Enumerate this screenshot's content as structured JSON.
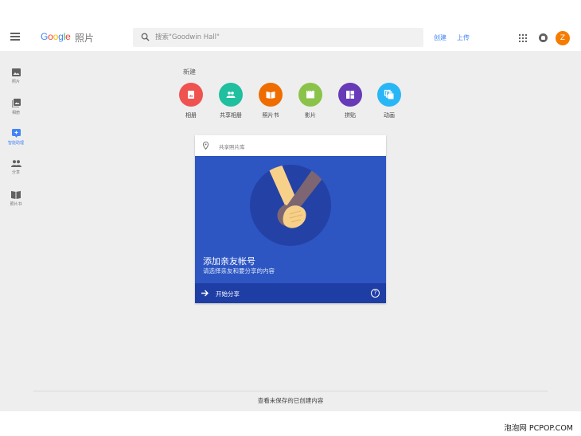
{
  "header": {
    "logo_letters": [
      "G",
      "o",
      "o",
      "g",
      "l",
      "e"
    ],
    "product": "照片",
    "search_placeholder": "搜索\"Goodwin Hall\"",
    "create_link": "创建",
    "upload_link": "上传",
    "avatar_letter": "Z",
    "avatar_color": "#f57c00"
  },
  "sidebar": {
    "items": [
      {
        "label": "照片",
        "icon": "photo-icon"
      },
      {
        "label": "相册",
        "icon": "album-icon"
      },
      {
        "label": "智能助理",
        "icon": "assistant-icon",
        "active": true
      },
      {
        "label": "分享",
        "icon": "people-icon"
      },
      {
        "label": "照片书",
        "icon": "photobook-icon"
      }
    ]
  },
  "create_section": {
    "label": "新建",
    "items": [
      {
        "label": "相册",
        "color": "#ef5350",
        "icon": "album-icon"
      },
      {
        "label": "共享相册",
        "color": "#1fbfa0",
        "icon": "shared-album-icon"
      },
      {
        "label": "照片书",
        "color": "#ef6c00",
        "icon": "photobook-icon"
      },
      {
        "label": "影片",
        "color": "#8bc34a",
        "icon": "movie-icon"
      },
      {
        "label": "拼贴",
        "color": "#673ab7",
        "icon": "collage-icon"
      },
      {
        "label": "动画",
        "color": "#29b6f6",
        "icon": "animation-icon"
      }
    ]
  },
  "card": {
    "header_text": "共享照片库",
    "title": "添加亲友帐号",
    "subtitle": "请选择亲友和要分享的内容",
    "action_label": "开始分享",
    "help_symbol": "?",
    "hero_color": "#2d56c3",
    "footer_color": "#1f3ea5"
  },
  "footer": {
    "link_text": "查看未保存的已创建内容"
  },
  "watermark": "泡泡网 PCPOP.COM"
}
